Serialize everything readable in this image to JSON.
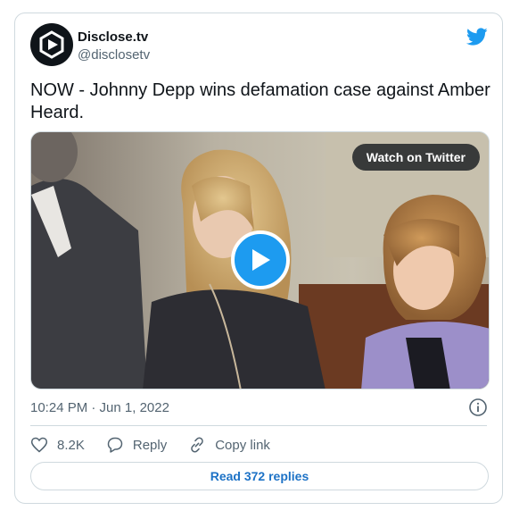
{
  "author": {
    "name": "Disclose.tv",
    "handle": "@disclosetv"
  },
  "tweet": {
    "text": "NOW - Johnny Depp wins defamation case against Amber Heard."
  },
  "media": {
    "watch_label": "Watch on Twitter"
  },
  "meta": {
    "timestamp": "10:24 PM · Jun 1, 2022"
  },
  "actions": {
    "likes": "8.2K",
    "reply_label": "Reply",
    "copy_label": "Copy link"
  },
  "replies_button": "Read 372 replies",
  "colors": {
    "brand": "#1d9bf0",
    "text": "#0f1419",
    "muted": "#536471",
    "border": "#cfd9de"
  }
}
